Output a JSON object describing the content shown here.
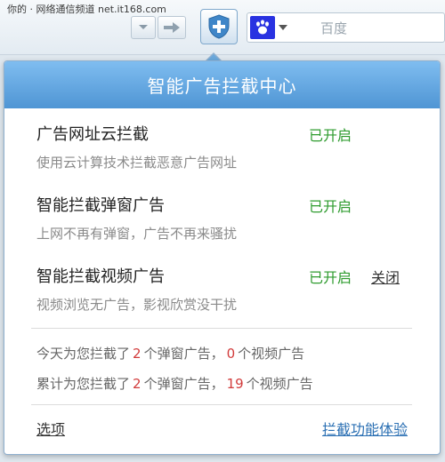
{
  "toolbar": {
    "watermark": "你的 · 网络通信频道 net.it168.com",
    "search_engine_placeholder": "百度",
    "shield_icon": "shield-plus-icon",
    "engine_icon": "paw-icon"
  },
  "popup": {
    "title": "智能广告拦截中心",
    "features": [
      {
        "name": "广告网址云拦截",
        "status": "已开启",
        "description": "使用云计算技术拦截恶意广告网址"
      },
      {
        "name": "智能拦截弹窗广告",
        "status": "已开启",
        "description": "上网不再有弹窗，广告不再来骚扰"
      },
      {
        "name": "智能拦截视频广告",
        "status": "已开启",
        "close_label": "关闭",
        "description": "视频浏览无广告，影视欣赏没干扰"
      }
    ],
    "stats": {
      "today": {
        "prefix": "今天为您拦截了",
        "popup_count": "2",
        "middle": "个弹窗广告，",
        "video_count": "0",
        "suffix": "个视频广告"
      },
      "total": {
        "prefix": "累计为您拦截了",
        "popup_count": "2",
        "middle": "个弹窗广告，",
        "video_count": "19",
        "suffix": "个视频广告"
      }
    },
    "options_label": "选项",
    "experience_label": "拦截功能体验"
  },
  "colors": {
    "header_top": "#7fbdf0",
    "header_bottom": "#4f95d4",
    "status_green": "#2e9b2e",
    "count_red": "#d23c3c",
    "link_blue": "#2a6fb3"
  }
}
